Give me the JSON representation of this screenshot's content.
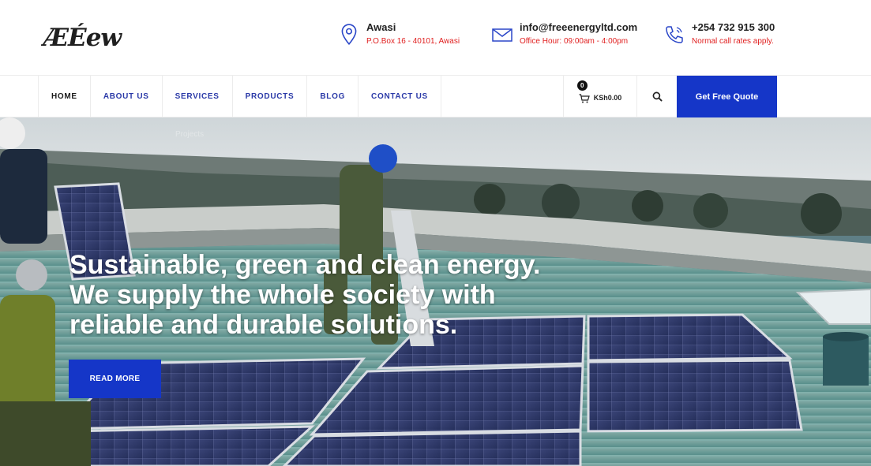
{
  "logo": {
    "text": "ÆÉew"
  },
  "contacts": {
    "location": {
      "icon": "map-pin-icon",
      "title": "Awasi",
      "subtitle": "P.O.Box 16 - 40101, Awasi"
    },
    "email": {
      "icon": "envelope-icon",
      "title": "info@freeenergyltd.com",
      "subtitle": "Office Hour: 09:00am - 4:00pm"
    },
    "phone": {
      "icon": "phone-icon",
      "title": "+254 732 915 300",
      "subtitle": "Normal call rates apply."
    }
  },
  "nav": {
    "items": [
      {
        "label": "HOME",
        "active": true
      },
      {
        "label": "ABOUT US"
      },
      {
        "label": "SERVICES"
      },
      {
        "label": "PRODUCTS"
      },
      {
        "label": "BLOG"
      },
      {
        "label": "CONTACT US"
      }
    ],
    "submenu_hint": "Projects"
  },
  "cart": {
    "count": "0",
    "total": "KSh0.00",
    "icon": "cart-icon"
  },
  "search": {
    "icon": "search-icon"
  },
  "quote_button": "Get Free Quote",
  "hero": {
    "headline_lines": [
      "Sustainable, green and clean energy.",
      "We supply the whole society with",
      "reliable and durable solutions."
    ],
    "cta": "READ MORE"
  },
  "colors": {
    "accent": "#1536c8",
    "subtitle_red": "#e02020",
    "nav_link": "#2b3aa8"
  }
}
